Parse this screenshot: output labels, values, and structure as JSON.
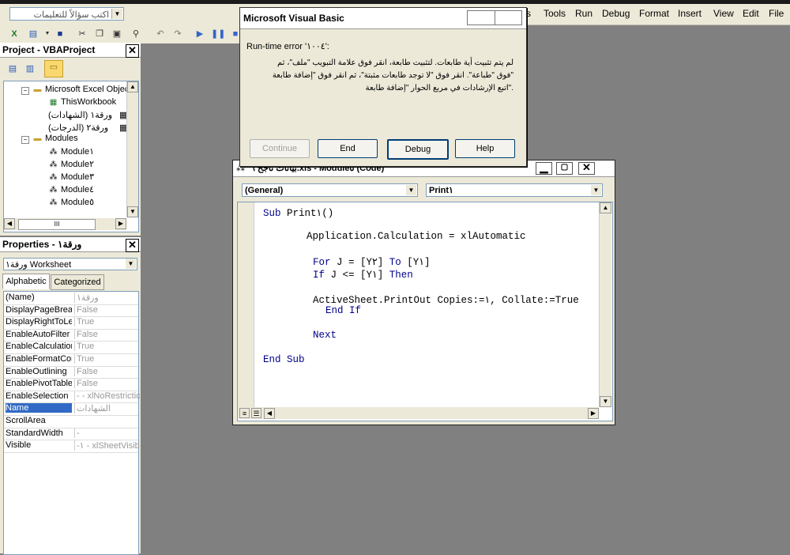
{
  "help_search": {
    "placeholder": "اكتب سؤالاً للتعليمات"
  },
  "menu": [
    {
      "label": "s"
    },
    {
      "label": "Tools"
    },
    {
      "label": "Run"
    },
    {
      "label": "Debug"
    },
    {
      "label": "Format"
    },
    {
      "label": "Insert"
    },
    {
      "label": "View"
    },
    {
      "label": "Edit"
    },
    {
      "label": "File"
    }
  ],
  "project_panel": {
    "title": "Project - VBAProject",
    "tree": [
      {
        "label": "Microsoft Excel Objec"
      },
      {
        "label": "ThisWorkbook"
      },
      {
        "label": "(ورقة١ (الشهادات"
      },
      {
        "label": "(ورقة٢ (الدرجات"
      },
      {
        "label": "Modules"
      },
      {
        "label": "Module١"
      },
      {
        "label": "Module٢"
      },
      {
        "label": "Module٣"
      },
      {
        "label": "Module٤"
      },
      {
        "label": "Module٥"
      }
    ],
    "scroll_thumb": "III"
  },
  "properties_panel": {
    "title": "Properties - ورقة١",
    "object_combo": "ورقة١ Worksheet",
    "tabs": [
      {
        "label": "Alphabetic"
      },
      {
        "label": "Categorized"
      }
    ],
    "rows": [
      {
        "key": "(Name)",
        "value": "ورقة١"
      },
      {
        "key": "DisplayPageBreak",
        "value": "False"
      },
      {
        "key": "DisplayRightToLef",
        "value": "True"
      },
      {
        "key": "EnableAutoFilter",
        "value": "False"
      },
      {
        "key": "EnableCalculation",
        "value": "True"
      },
      {
        "key": "EnableFormatCon",
        "value": "True"
      },
      {
        "key": "EnableOutlining",
        "value": "False"
      },
      {
        "key": "EnablePivotTable",
        "value": "False"
      },
      {
        "key": "EnableSelection",
        "value": "- - xlNoRestrictio"
      },
      {
        "key": "Name",
        "value": "الشهادات"
      },
      {
        "key": "ScrollArea",
        "value": ""
      },
      {
        "key": "StandardWidth",
        "value": "-"
      },
      {
        "key": "Visible",
        "value": "-١ - xlSheetVisib"
      }
    ]
  },
  "dialog": {
    "title": "Microsoft Visual Basic",
    "error": "Run-time error '١٠٠٤':",
    "message": [
      "لم يتم تثبيت أية طابعات. لتثبيت طابعة، انقر فوق علامة التبويب \"ملف\"، ثم",
      "\"فوق \"طباعة\". انقر فوق \"لا توجد طابعات مثبتة\"، ثم انقر فوق \"إضافة طابعة",
      ".\"اتبع الإرشادات في مربع الحوار \"إضافة طابعة"
    ],
    "buttons": {
      "continue": "Continue",
      "end": "End",
      "debug": "Debug",
      "help": "Help"
    }
  },
  "code_window": {
    "title": "بيانات ناجح ٦.xls - Module٥ (Code)",
    "object_combo": "(General)",
    "proc_combo": "Print١"
  }
}
